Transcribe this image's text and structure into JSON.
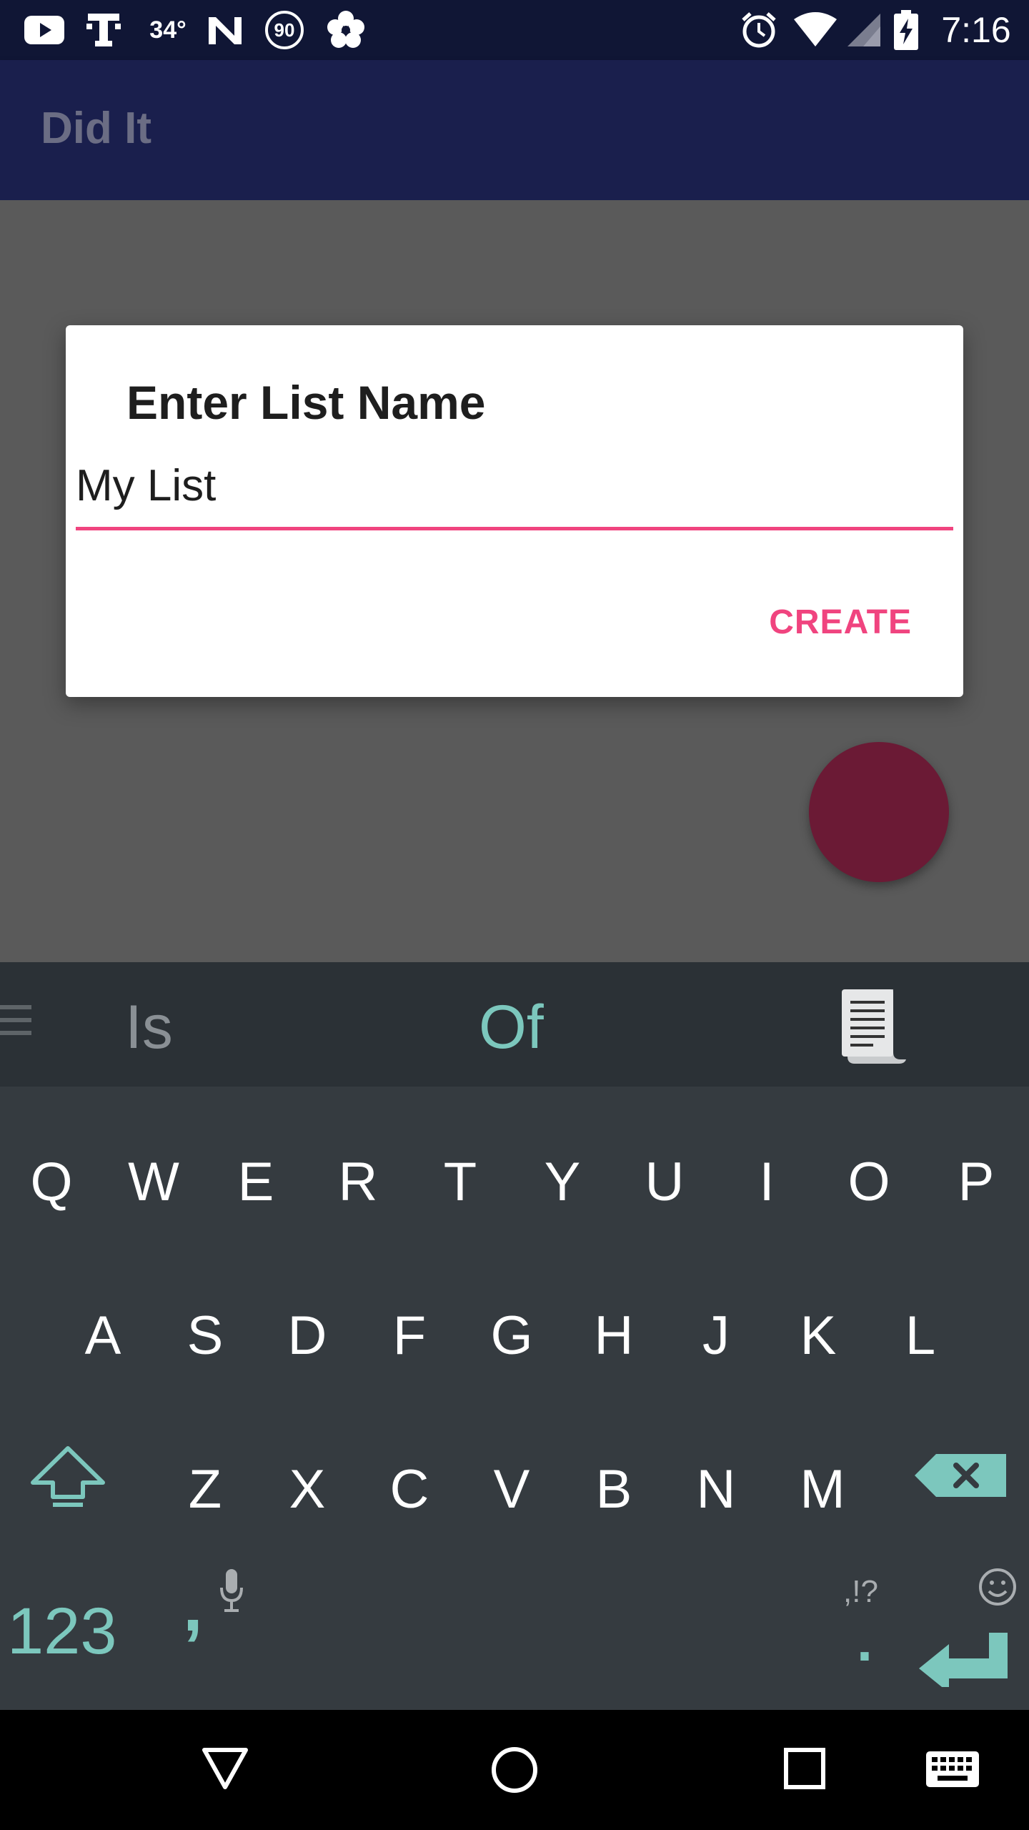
{
  "status_bar": {
    "temperature": "34°",
    "speed_badge": "90",
    "time": "7:16",
    "icons": [
      "youtube-icon",
      "tmobile-icon",
      "weather-icon",
      "n-icon",
      "speed-90-icon",
      "flower-icon",
      "alarm-icon",
      "wifi-icon",
      "signal-icon",
      "battery-charging-icon"
    ]
  },
  "app_bar": {
    "title": "Did It"
  },
  "dialog": {
    "title": "Enter List Name",
    "input_value": "My List",
    "create_label": "CREATE",
    "accent": "#f0447f"
  },
  "fab": {
    "color": "#6b1a35"
  },
  "keyboard": {
    "suggestions": [
      "Is",
      "Of"
    ],
    "row1": [
      "Q",
      "W",
      "E",
      "R",
      "T",
      "Y",
      "U",
      "I",
      "O",
      "P"
    ],
    "row2": [
      "A",
      "S",
      "D",
      "F",
      "G",
      "H",
      "J",
      "K",
      "L"
    ],
    "row3": [
      "Z",
      "X",
      "C",
      "V",
      "B",
      "N",
      "M"
    ],
    "numbers_label": "123",
    "comma_label": ",",
    "period_label": ".",
    "punct_hint": ",!?",
    "accent": "#7cc7bd"
  },
  "nav_bar": {
    "icons": [
      "back-icon",
      "home-icon",
      "recents-icon",
      "keyboard-switch-icon"
    ]
  }
}
